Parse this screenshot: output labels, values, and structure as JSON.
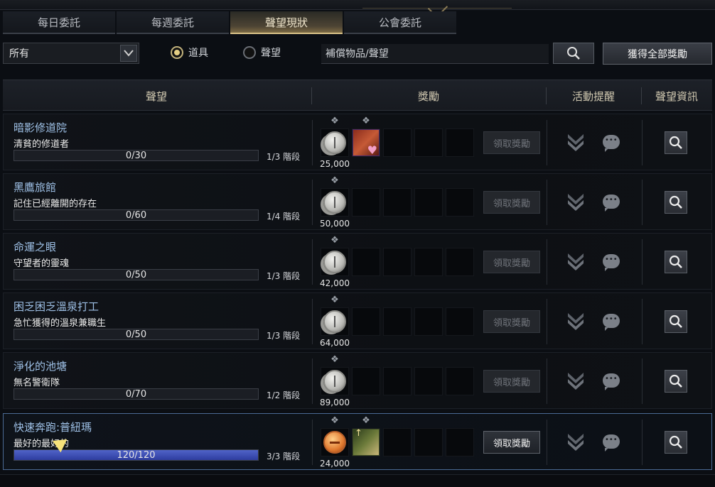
{
  "tabs": [
    {
      "label": "每日委託",
      "active": false
    },
    {
      "label": "每週委託",
      "active": false
    },
    {
      "label": "聲望現狀",
      "active": true
    },
    {
      "label": "公會委託",
      "active": false
    }
  ],
  "filter": {
    "selected": "所有"
  },
  "radios": [
    {
      "label": "道具",
      "checked": true
    },
    {
      "label": "聲望",
      "checked": false
    }
  ],
  "search": {
    "placeholder": "補償物品/聲望"
  },
  "claim_all_label": "獲得全部獎勵",
  "columns": {
    "reputation": "聲望",
    "rewards": "獎勵",
    "alert": "活動提醒",
    "info": "聲望資訊"
  },
  "rows": [
    {
      "name": "暗影修道院",
      "subtitle": "清貧的修道者",
      "progress": "0/30",
      "fraction": 0,
      "stage": "1/3 階段",
      "qty": "25,000",
      "claim": "領取獎勵",
      "enabled": false,
      "reward_icons": [
        "silver-coin-icon",
        "heart-chest-icon"
      ]
    },
    {
      "name": "黑鷹旅館",
      "subtitle": "記住已經離開的存在",
      "progress": "0/60",
      "fraction": 0,
      "stage": "1/4 階段",
      "qty": "50,000",
      "claim": "領取獎勵",
      "enabled": false,
      "reward_icons": [
        "silver-coin-icon"
      ]
    },
    {
      "name": "命運之眼",
      "subtitle": "守望者的靈魂",
      "progress": "0/50",
      "fraction": 0,
      "stage": "1/3 階段",
      "qty": "42,000",
      "claim": "領取獎勵",
      "enabled": false,
      "reward_icons": [
        "silver-coin-icon"
      ]
    },
    {
      "name": "困乏困乏溫泉打工",
      "subtitle": "急忙獲得的溫泉兼職生",
      "progress": "0/50",
      "fraction": 0,
      "stage": "1/3 階段",
      "qty": "64,000",
      "claim": "領取獎勵",
      "enabled": false,
      "reward_icons": [
        "silver-coin-icon"
      ]
    },
    {
      "name": "淨化的池塘",
      "subtitle": "無名警衛隊",
      "progress": "0/70",
      "fraction": 0,
      "stage": "1/2 階段",
      "qty": "89,000",
      "claim": "領取獎勵",
      "enabled": false,
      "reward_icons": [
        "silver-coin-icon"
      ]
    },
    {
      "name": "快速奔跑:普紐瑪",
      "subtitle": "最好的最好的",
      "progress": "120/120",
      "fraction": 1,
      "stage": "3/3 階段",
      "qty": "24,000",
      "claim": "領取獎勵",
      "enabled": true,
      "reward_icons": [
        "gold-coin-icon",
        "scroll-item-icon"
      ]
    }
  ],
  "colors": {
    "accent_gold": "#d9c288",
    "name_blue": "#9ec0e6",
    "progress_blue": "#3e50b8",
    "highlight_border": "#4b6a94"
  }
}
